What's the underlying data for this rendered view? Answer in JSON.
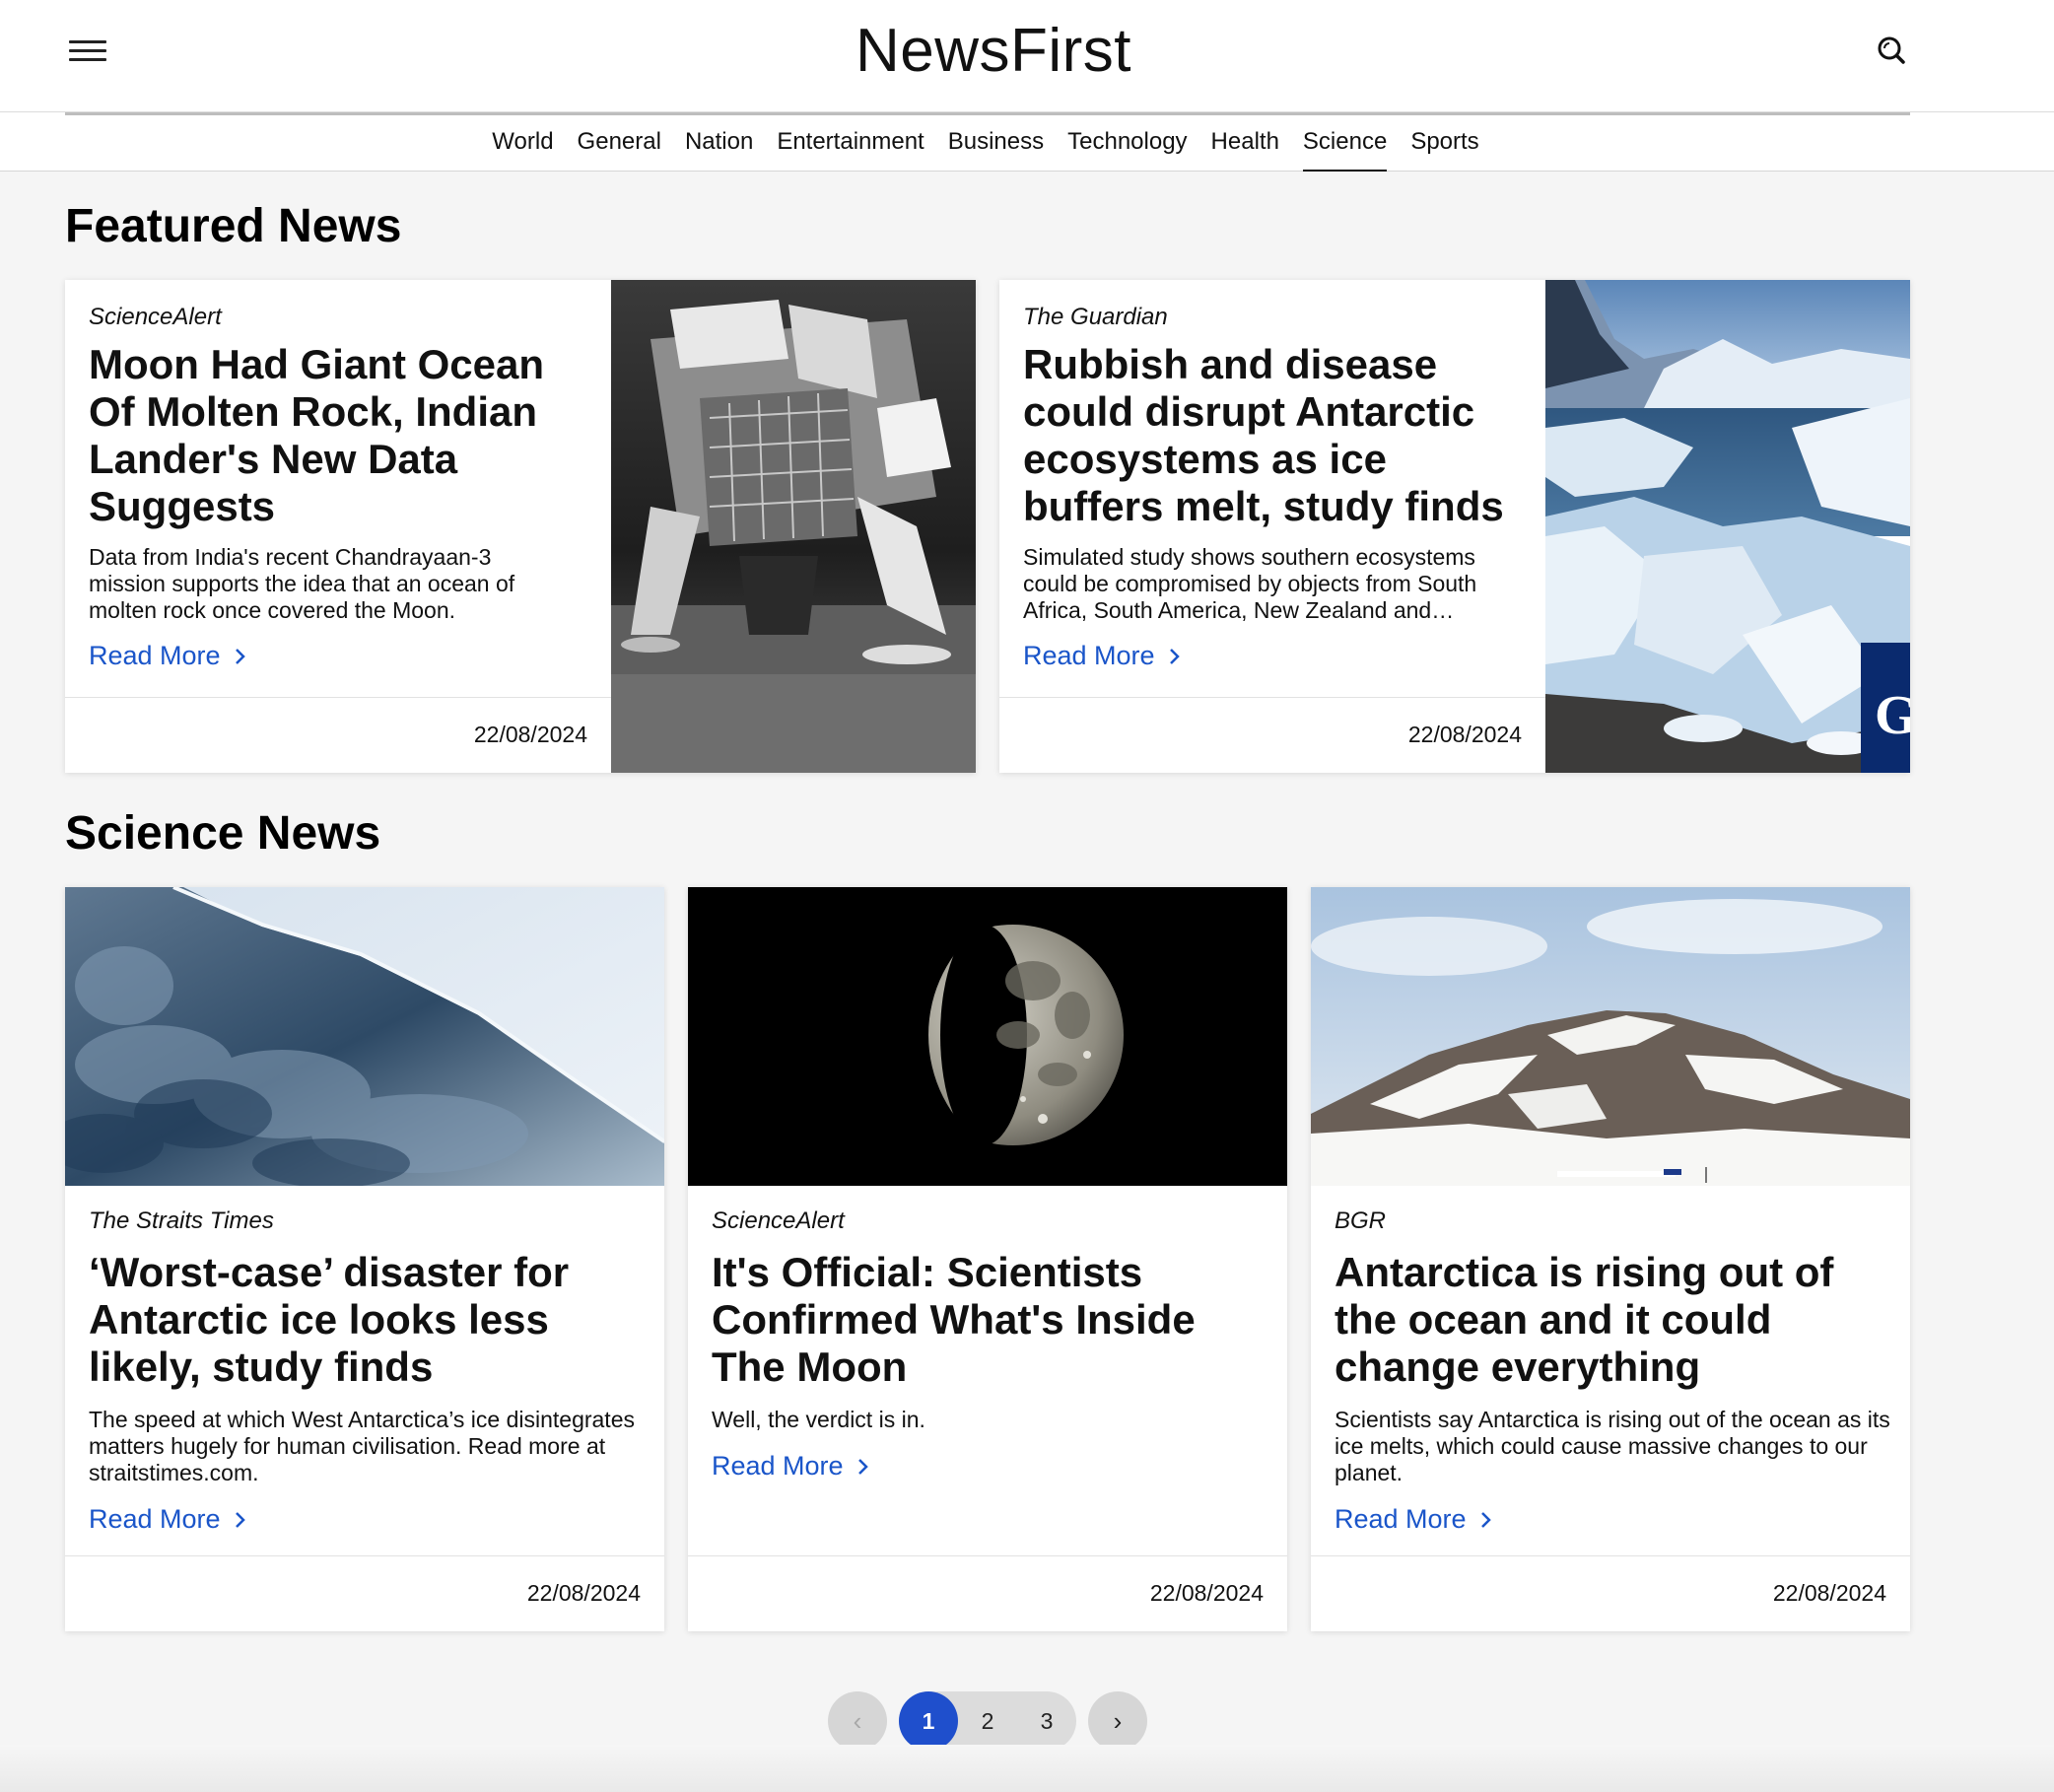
{
  "header": {
    "logo": "NewsFirst"
  },
  "nav": {
    "items": [
      "World",
      "General",
      "Nation",
      "Entertainment",
      "Business",
      "Technology",
      "Health",
      "Science",
      "Sports"
    ],
    "active": "Science"
  },
  "featured": {
    "title": "Featured News",
    "cards": [
      {
        "source": "ScienceAlert",
        "headline": "Moon Had Giant Ocean Of Molten Rock, Indian Lander's New Data Suggests",
        "description": "Data from India's recent Chandrayaan-3 mission supports the idea that an ocean of molten rock once covered the Moon.",
        "read_more": "Read More",
        "date": "22/08/2024"
      },
      {
        "source": "The Guardian",
        "headline": "Rubbish and disease could disrupt Antarctic ecosystems as ice buffers melt, study finds",
        "description": "Simulated study shows southern ecosystems could be compromised by objects from South Africa, South America, New Zealand and…",
        "read_more": "Read More",
        "date": "22/08/2024",
        "badge": "G"
      }
    ]
  },
  "science": {
    "title": "Science News",
    "cards": [
      {
        "source": "The Straits Times",
        "headline": "‘Worst-case’ disaster for Antarctic ice looks less likely, study finds",
        "description": "The speed at which West Antarctica’s ice disintegrates matters hugely for human civilisation. Read more at straitstimes.com.",
        "read_more": "Read More",
        "date": "22/08/2024"
      },
      {
        "source": "ScienceAlert",
        "headline": "It's Official: Scientists Confirmed What's Inside The Moon",
        "description": "Well, the verdict is in.",
        "read_more": "Read More",
        "date": "22/08/2024"
      },
      {
        "source": "BGR",
        "headline": "Antarctica is rising out of the ocean and it could change everything",
        "description": "Scientists say Antarctica is rising out of the ocean as its ice melts, which could cause massive changes to our planet.",
        "read_more": "Read More",
        "date": "22/08/2024"
      }
    ]
  },
  "pagination": {
    "prev": "‹",
    "pages": [
      "1",
      "2",
      "3"
    ],
    "current": "1",
    "next": "›"
  },
  "colors": {
    "accent": "#1a55c9",
    "pager_active": "#1f4fcc"
  }
}
